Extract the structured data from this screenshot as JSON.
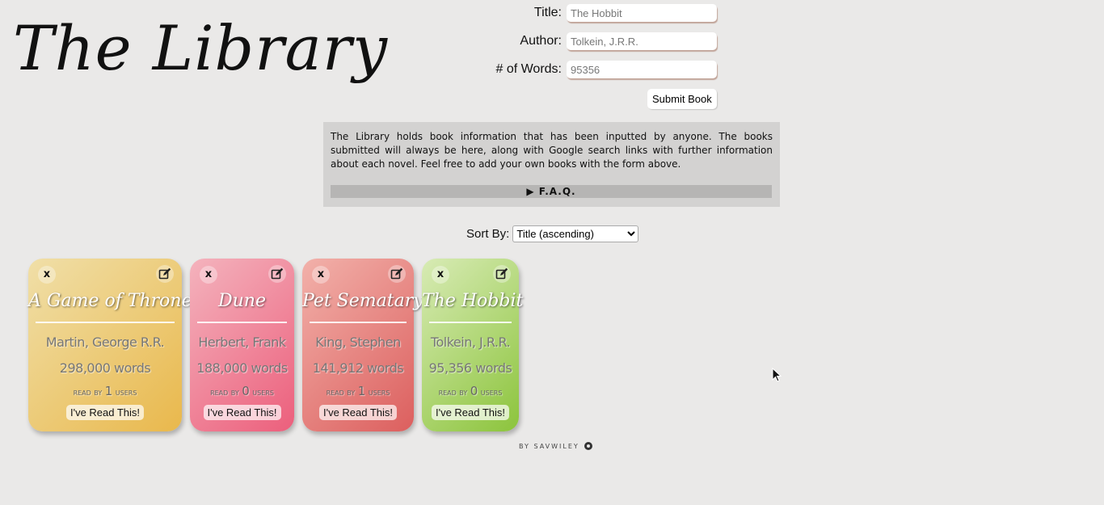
{
  "header": {
    "title": "The Library"
  },
  "form": {
    "title_label": "Title:",
    "title_placeholder": "The Hobbit",
    "author_label": "Author:",
    "author_placeholder": "Tolkein, J.R.R.",
    "words_label": "# of Words:",
    "words_placeholder": "95356",
    "submit_label": "Submit Book"
  },
  "info": {
    "text": "The Library holds book information that has been inputted by anyone. The books submitted will always be here, along with Google search links with further information about each novel. Feel free to add your own books with the form above.",
    "faq_label": "▶ F.A.Q."
  },
  "sort": {
    "label": "Sort By:",
    "selected": "Title (ascending)"
  },
  "books": [
    {
      "title": "A Game of Thrones",
      "author": "Martin, George R.R.",
      "words": "298,000 words",
      "read_prefix": "read by",
      "read_count": "1",
      "read_suffix": "users",
      "read_button": "I've Read This!",
      "close_label": "x",
      "colors": [
        "#f0dfa8",
        "#e9b84c"
      ]
    },
    {
      "title": "Dune",
      "author": "Herbert, Frank",
      "words": "188,000 words",
      "read_prefix": "read by",
      "read_count": "0",
      "read_suffix": "users",
      "read_button": "I've Read This!",
      "close_label": "x",
      "colors": [
        "#f4b3bd",
        "#ec5f7c"
      ]
    },
    {
      "title": "Pet Sematary",
      "author": "King, Stephen",
      "words": "141,912 words",
      "read_prefix": "read by",
      "read_count": "1",
      "read_suffix": "users",
      "read_button": "I've Read This!",
      "close_label": "x",
      "colors": [
        "#f2b1aa",
        "#dc5f5e"
      ]
    },
    {
      "title": "The Hobbit",
      "author": "Tolkein, J.R.R.",
      "words": "95,356 words",
      "read_prefix": "read by",
      "read_count": "0",
      "read_suffix": "users",
      "read_button": "I've Read This!",
      "close_label": "x",
      "colors": [
        "#d8ebb5",
        "#8cc43c"
      ]
    }
  ],
  "footer": {
    "text": "BY SAVWILEY"
  }
}
